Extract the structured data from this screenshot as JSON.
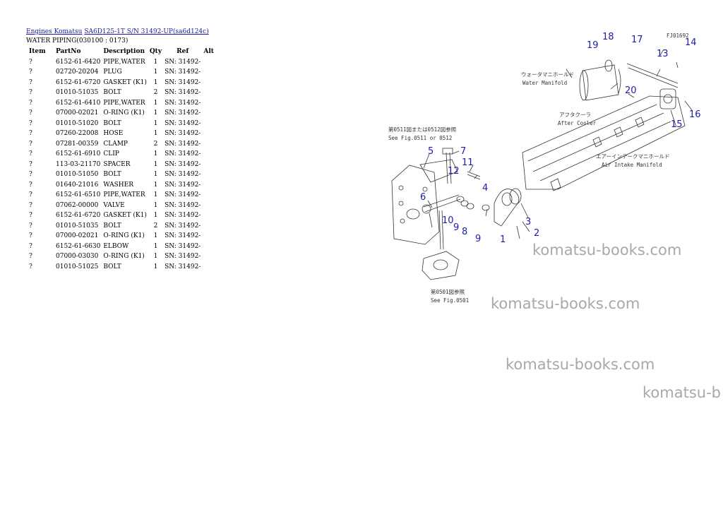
{
  "breadcrumb": {
    "link1": "Engines Komatsu",
    "link2": "SA6D125-1T S/N 31492-UP(sa6d124c)"
  },
  "subtitle": "WATER PIPING(030100 : 0173)",
  "table": {
    "headers": [
      "Item",
      "PartNo",
      "Description",
      "Qty",
      "Ref",
      "Alt"
    ],
    "rows": [
      [
        "?",
        "6152-61-6420",
        "PIPE,WATER",
        "1",
        "SN: 31492-",
        ""
      ],
      [
        "?",
        "02720-20204",
        "PLUG",
        "1",
        "SN: 31492-",
        ""
      ],
      [
        "?",
        "6152-61-6720",
        "GASKET (K1)",
        "1",
        "SN: 31492-",
        ""
      ],
      [
        "?",
        "01010-51035",
        "BOLT",
        "2",
        "SN: 31492-",
        ""
      ],
      [
        "?",
        "6152-61-6410",
        "PIPE,WATER",
        "1",
        "SN: 31492-",
        ""
      ],
      [
        "?",
        "07000-02021",
        "O-RING (K1)",
        "1",
        "SN: 31492-",
        ""
      ],
      [
        "?",
        "01010-51020",
        "BOLT",
        "1",
        "SN: 31492-",
        ""
      ],
      [
        "?",
        "07260-22008",
        "HOSE",
        "1",
        "SN: 31492-",
        ""
      ],
      [
        "?",
        "07281-00359",
        "CLAMP",
        "2",
        "SN: 31492-",
        ""
      ],
      [
        "?",
        "6152-61-6910",
        "CLIP",
        "1",
        "SN: 31492-",
        ""
      ],
      [
        "?",
        "113-03-21170",
        "SPACER",
        "1",
        "SN: 31492-",
        ""
      ],
      [
        "?",
        "01010-51050",
        "BOLT",
        "1",
        "SN: 31492-",
        ""
      ],
      [
        "?",
        "01640-21016",
        "WASHER",
        "1",
        "SN: 31492-",
        ""
      ],
      [
        "?",
        "6152-61-6510",
        "PIPE,WATER",
        "1",
        "SN: 31492-",
        ""
      ],
      [
        "?",
        "07062-00000",
        "VALVE",
        "1",
        "SN: 31492-",
        ""
      ],
      [
        "?",
        "6152-61-6720",
        "GASKET (K1)",
        "1",
        "SN: 31492-",
        ""
      ],
      [
        "?",
        "01010-51035",
        "BOLT",
        "2",
        "SN: 31492-",
        ""
      ],
      [
        "?",
        "07000-02021",
        "O-RING (K1)",
        "1",
        "SN: 31492-",
        ""
      ],
      [
        "?",
        "6152-61-6630",
        "ELBOW",
        "1",
        "SN: 31492-",
        ""
      ],
      [
        "?",
        "07000-03030",
        "O-RING (K1)",
        "1",
        "SN: 31492-",
        ""
      ],
      [
        "?",
        "01010-51025",
        "BOLT",
        "1",
        "SN: 31492-",
        ""
      ]
    ]
  },
  "diagram": {
    "callouts": [
      "1",
      "2",
      "3",
      "4",
      "5",
      "6",
      "7",
      "8",
      "9",
      "9",
      "10",
      "11",
      "12",
      "13",
      "14",
      "15",
      "16",
      "17",
      "18",
      "19",
      "20",
      "21"
    ],
    "labels": {
      "code": "FJ01692",
      "water_manifold_jp": "ウォータマニホールド",
      "water_manifold": "Water Manifold",
      "after_cooler_jp": "アフタクーラ",
      "after_cooler": "After Cooler",
      "air_intake_jp": "エアーインテークマニホールド",
      "air_intake": "Air Intake Manifold",
      "fig_ref_top_jp": "第0511図または0512図参照",
      "fig_ref_top": "See Fig.0511 or 0512",
      "fig_ref_bottom_jp": "第0501図参照",
      "fig_ref_bottom": "See Fig.0501"
    },
    "callout_color": "#1c1ca8"
  },
  "watermarks": [
    "komatsu-books.com",
    "komatsu-books.com",
    "komatsu-books.com",
    "komatsu-b"
  ]
}
